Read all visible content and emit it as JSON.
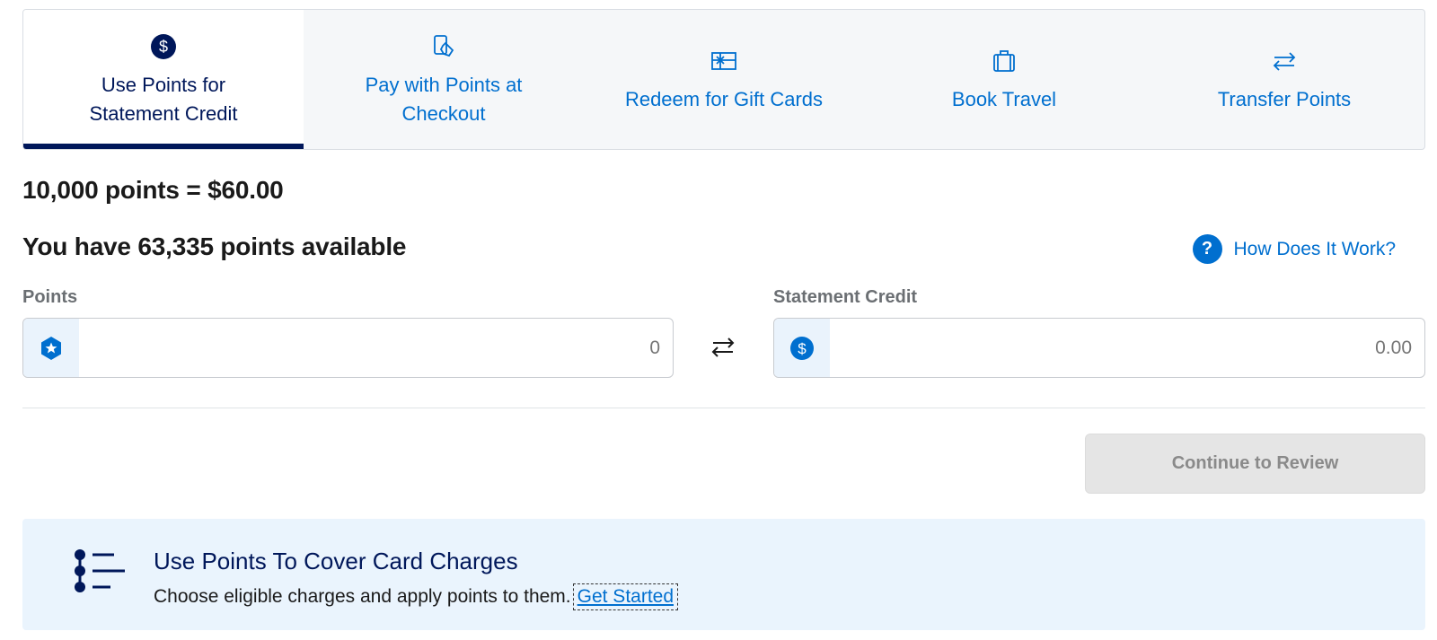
{
  "tabs": [
    {
      "label": "Use Points for Statement Credit",
      "icon": "dollar-circle-icon",
      "active": true
    },
    {
      "label": "Pay with Points at Checkout",
      "icon": "phone-tap-icon",
      "active": false
    },
    {
      "label": "Redeem for Gift Cards",
      "icon": "gift-card-icon",
      "active": false
    },
    {
      "label": "Book Travel",
      "icon": "suitcase-icon",
      "active": false
    },
    {
      "label": "Transfer Points",
      "icon": "transfer-arrows-icon",
      "active": false
    }
  ],
  "rate": "10,000 points = $60.00",
  "available": "You have 63,335 points available",
  "how_link": {
    "label": "How Does It Work?",
    "icon_glyph": "?"
  },
  "points_field": {
    "label": "Points",
    "value": "",
    "placeholder": "0"
  },
  "credit_field": {
    "label": "Statement Credit",
    "value": "",
    "placeholder": "0.00"
  },
  "continue_button": "Continue to Review",
  "promo": {
    "title": "Use Points To Cover Card Charges",
    "text": "Choose eligible charges and apply points to them.",
    "link": "Get Started"
  },
  "colors": {
    "brand_blue": "#006fcf",
    "navy": "#00175a",
    "disabled_bg": "#e5e5e5",
    "promo_bg": "#eaf4fd"
  }
}
